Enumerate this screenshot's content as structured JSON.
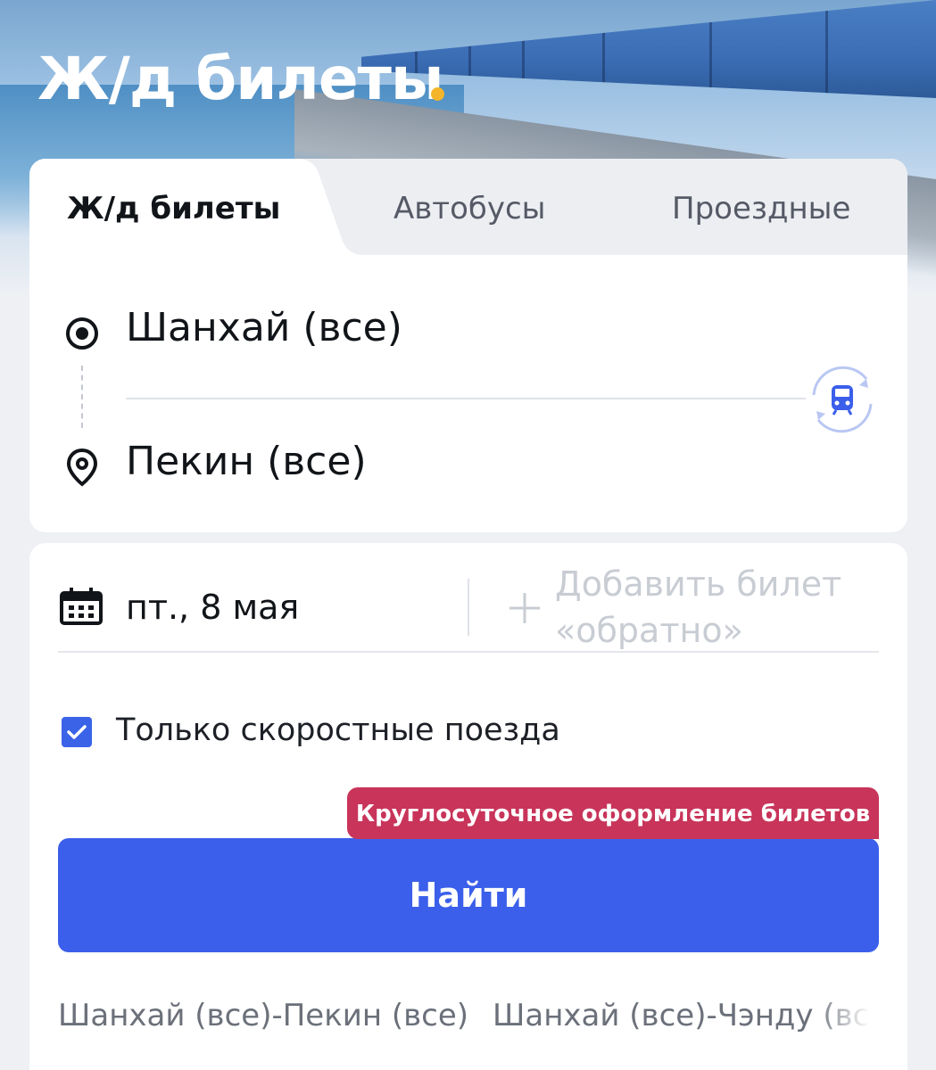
{
  "hero": {
    "title": "Ж/д билеты",
    "dot_color": "#f5b52a",
    "image": "train-by-sea-photo"
  },
  "tabs": [
    {
      "label": "Ж/д билеты",
      "active": true
    },
    {
      "label": "Автобусы",
      "active": false
    },
    {
      "label": "Проездные",
      "active": false
    }
  ],
  "route": {
    "from": {
      "name": "Шанхай (все)",
      "icon": "origin-target-icon"
    },
    "to": {
      "name": "Пекин (все)",
      "icon": "location-pin-icon"
    },
    "swap_icon": "swap-train-icon"
  },
  "date": {
    "icon": "calendar-icon",
    "value": "пт., 8 мая",
    "return_placeholder": "Добавить билет «обратно»"
  },
  "options": {
    "high_speed_only": {
      "label": "Только скоростные поезда",
      "checked": true
    }
  },
  "promo": {
    "text": "Круглосуточное оформление билетов",
    "color": "#c8345a"
  },
  "search_button": {
    "label": "Найти",
    "color": "#3b5fea"
  },
  "recent_searches": [
    "Шанхай (все)-Пекин (все)",
    "Шанхай (все)-Чэнду (все)"
  ]
}
